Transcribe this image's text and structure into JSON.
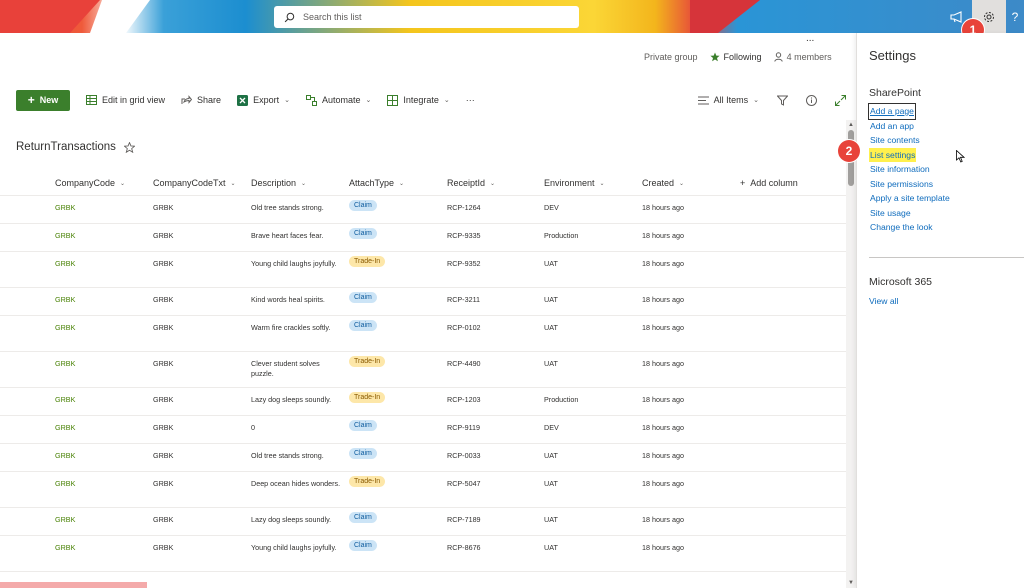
{
  "suitebar": {
    "search_placeholder": "Search this list",
    "help_label": "?",
    "badge_1": "1"
  },
  "group": {
    "privacy": "Private group",
    "following": "Following",
    "members": "4 members",
    "more": "..."
  },
  "commands": {
    "new": "New",
    "edit_grid": "Edit in grid view",
    "share": "Share",
    "export": "Export",
    "automate": "Automate",
    "integrate": "Integrate",
    "more": "···",
    "view": "All Items"
  },
  "list": {
    "title": "ReturnTransactions",
    "columns": [
      "CompanyCode",
      "CompanyCodeTxt",
      "Description",
      "AttachType",
      "ReceiptId",
      "Environment",
      "Created"
    ],
    "add_column": "Add column",
    "rows": [
      {
        "code": "GRBK",
        "codetxt": "GRBK",
        "desc": "Old tree stands strong.",
        "type": "Claim",
        "receipt": "RCP-1264",
        "env": "DEV",
        "created": "18 hours ago"
      },
      {
        "code": "GRBK",
        "codetxt": "GRBK",
        "desc": "Brave heart faces fear.",
        "type": "Claim",
        "receipt": "RCP-9335",
        "env": "Production",
        "created": "18 hours ago"
      },
      {
        "code": "GRBK",
        "codetxt": "GRBK",
        "desc": "Young child laughs joyfully.",
        "type": "Trade-In",
        "receipt": "RCP-9352",
        "env": "UAT",
        "created": "18 hours ago"
      },
      {
        "code": "GRBK",
        "codetxt": "GRBK",
        "desc": "Kind words heal spirits.",
        "type": "Claim",
        "receipt": "RCP-3211",
        "env": "UAT",
        "created": "18 hours ago"
      },
      {
        "code": "GRBK",
        "codetxt": "GRBK",
        "desc": "Warm fire crackles softly.",
        "type": "Claim",
        "receipt": "RCP-0102",
        "env": "UAT",
        "created": "18 hours ago"
      },
      {
        "code": "GRBK",
        "codetxt": "GRBK",
        "desc": "Clever student solves puzzle.",
        "type": "Trade-In",
        "receipt": "RCP-4490",
        "env": "UAT",
        "created": "18 hours ago"
      },
      {
        "code": "GRBK",
        "codetxt": "GRBK",
        "desc": "Lazy dog sleeps soundly.",
        "type": "Trade-In",
        "receipt": "RCP-1203",
        "env": "Production",
        "created": "18 hours ago"
      },
      {
        "code": "GRBK",
        "codetxt": "GRBK",
        "desc": "0",
        "type": "Claim",
        "receipt": "RCP-9119",
        "env": "DEV",
        "created": "18 hours ago"
      },
      {
        "code": "GRBK",
        "codetxt": "GRBK",
        "desc": "Old tree stands strong.",
        "type": "Claim",
        "receipt": "RCP-0033",
        "env": "UAT",
        "created": "18 hours ago"
      },
      {
        "code": "GRBK",
        "codetxt": "GRBK",
        "desc": "Deep ocean hides wonders.",
        "type": "Trade-In",
        "receipt": "RCP-5047",
        "env": "UAT",
        "created": "18 hours ago"
      },
      {
        "code": "GRBK",
        "codetxt": "GRBK",
        "desc": "Lazy dog sleeps soundly.",
        "type": "Claim",
        "receipt": "RCP-7189",
        "env": "UAT",
        "created": "18 hours ago"
      },
      {
        "code": "GRBK",
        "codetxt": "GRBK",
        "desc": "Young child laughs joyfully.",
        "type": "Claim",
        "receipt": "RCP-8676",
        "env": "UAT",
        "created": "18 hours ago"
      }
    ]
  },
  "settings": {
    "title": "Settings",
    "sharepoint_heading": "SharePoint",
    "links": [
      "Add a page",
      "Add an app",
      "Site contents",
      "List settings",
      "Site information",
      "Site permissions",
      "Apply a site template",
      "Site usage",
      "Change the look"
    ],
    "m365_heading": "Microsoft 365",
    "view_all": "View all",
    "badge_2": "2"
  },
  "colors": {
    "accent_green": "#3b7f2c",
    "link_blue": "#0f6cbd",
    "highlight_yellow": "#fff04d",
    "badge_red": "#e8433a"
  }
}
